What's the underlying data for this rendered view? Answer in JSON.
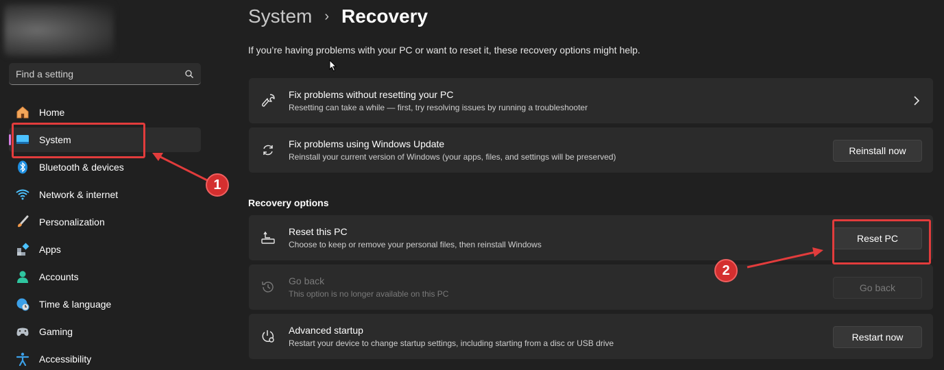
{
  "sidebar": {
    "search": {
      "placeholder": "Find a setting"
    },
    "items": [
      {
        "label": "Home",
        "icon": "home-icon"
      },
      {
        "label": "System",
        "icon": "system-icon",
        "active": true
      },
      {
        "label": "Bluetooth & devices",
        "icon": "bluetooth-icon"
      },
      {
        "label": "Network & internet",
        "icon": "wifi-icon"
      },
      {
        "label": "Personalization",
        "icon": "brush-icon"
      },
      {
        "label": "Apps",
        "icon": "apps-icon"
      },
      {
        "label": "Accounts",
        "icon": "person-icon"
      },
      {
        "label": "Time & language",
        "icon": "globe-clock-icon"
      },
      {
        "label": "Gaming",
        "icon": "gamepad-icon"
      },
      {
        "label": "Accessibility",
        "icon": "accessibility-icon"
      }
    ]
  },
  "header": {
    "breadcrumb_parent": "System",
    "breadcrumb_separator": "›",
    "breadcrumb_current": "Recovery"
  },
  "main": {
    "intro": "If you’re having problems with your PC or want to reset it, these recovery options might help.",
    "cards": [
      {
        "title": "Fix problems without resetting your PC",
        "subtitle": "Resetting can take a while — first, try resolving issues by running a troubleshooter",
        "icon": "wrench-icon"
      },
      {
        "title": "Fix problems using Windows Update",
        "subtitle": "Reinstall your current version of Windows (your apps, files, and settings will be preserved)",
        "icon": "refresh-icon",
        "button": "Reinstall now"
      }
    ],
    "section_title": "Recovery options",
    "recovery": [
      {
        "title": "Reset this PC",
        "subtitle": "Choose to keep or remove your personal files, then reinstall Windows",
        "icon": "reset-pc-icon",
        "button": "Reset PC"
      },
      {
        "title": "Go back",
        "subtitle": "This option is no longer available on this PC",
        "icon": "history-icon",
        "button": "Go back",
        "disabled": true
      },
      {
        "title": "Advanced startup",
        "subtitle": "Restart your device to change startup settings, including starting from a disc or USB drive",
        "icon": "advanced-startup-icon",
        "button": "Restart now"
      }
    ]
  },
  "annotations": {
    "step1": "1",
    "step2": "2",
    "color": "#e23c3c"
  },
  "colors": {
    "background": "#202020",
    "card": "#2b2b2b",
    "accent": "#d680e6"
  }
}
